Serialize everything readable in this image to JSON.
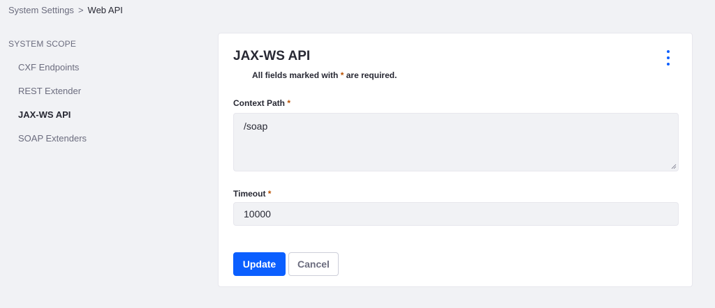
{
  "breadcrumb": {
    "parent": "System Settings",
    "separator": ">",
    "current": "Web API"
  },
  "sidebar": {
    "heading": "SYSTEM SCOPE",
    "items": [
      {
        "label": "CXF Endpoints",
        "active": false
      },
      {
        "label": "REST Extender",
        "active": false
      },
      {
        "label": "JAX-WS API",
        "active": true
      },
      {
        "label": "SOAP Extenders",
        "active": false
      }
    ]
  },
  "form": {
    "title": "JAX-WS API",
    "required_note_before": "All fields marked with",
    "required_star": "*",
    "required_note_after": "are required.",
    "options_icon": "ellipsis-vertical-icon",
    "fields": {
      "context_path": {
        "label": "Context Path",
        "value": "/soap"
      },
      "timeout": {
        "label": "Timeout",
        "value": "10000"
      }
    },
    "buttons": {
      "update": "Update",
      "cancel": "Cancel"
    }
  },
  "colors": {
    "primary": "#0b5fff",
    "required": "#b95000",
    "background": "#f1f2f5",
    "text": "#272833",
    "muted": "#6b6c7e"
  }
}
